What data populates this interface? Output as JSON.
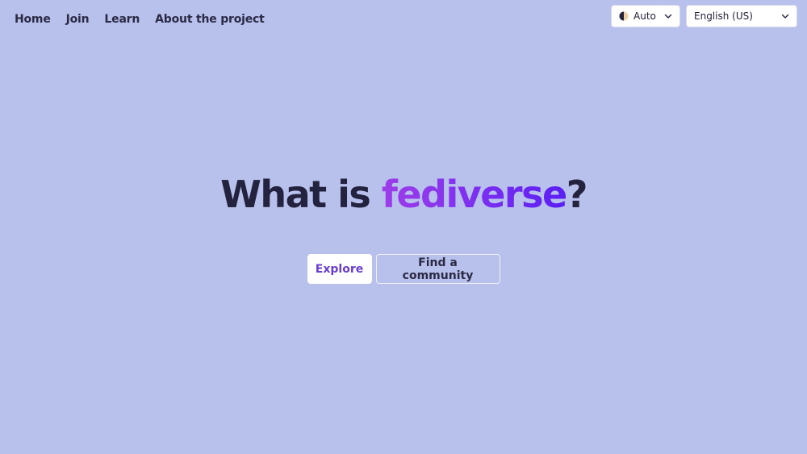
{
  "nav": {
    "items": [
      {
        "label": "Home"
      },
      {
        "label": "Join"
      },
      {
        "label": "Learn"
      },
      {
        "label": "About the project"
      }
    ]
  },
  "controls": {
    "theme": {
      "label": "Auto",
      "icon": "half-moon-icon"
    },
    "language": {
      "label": "English (US)",
      "icon": "chevron-down-icon"
    }
  },
  "hero": {
    "title_prefix": "What is ",
    "title_highlight": "fediverse",
    "title_suffix": "?"
  },
  "actions": {
    "explore_label": "Explore",
    "community_label": "Find a community"
  },
  "colors": {
    "background": "#b8c0ec",
    "text": "#23233f",
    "accent_start": "#9d3ee8",
    "accent_end": "#5a1ff2",
    "button_text": "#6a3fd0"
  }
}
